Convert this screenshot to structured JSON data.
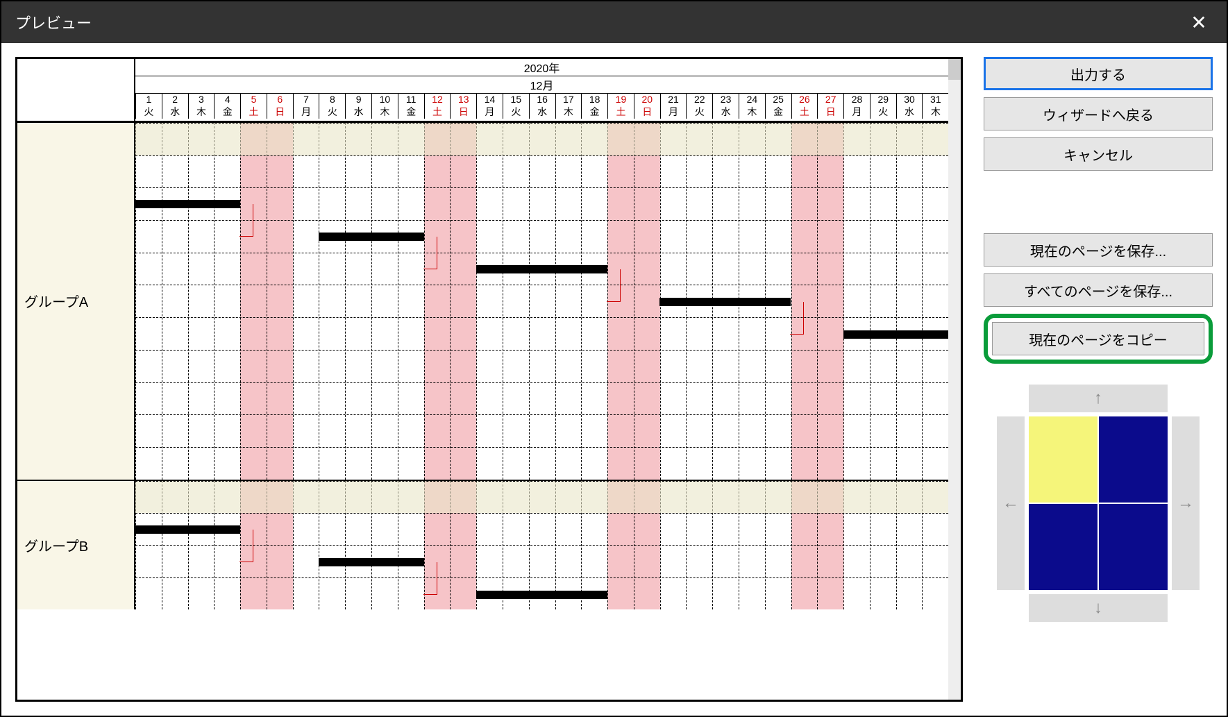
{
  "window": {
    "title": "プレビュー"
  },
  "buttons": {
    "output": "出力する",
    "back_wizard": "ウィザードへ戻る",
    "cancel": "キャンセル",
    "save_current": "現在のページを保存...",
    "save_all": "すべてのページを保存...",
    "copy_current": "現在のページをコピー"
  },
  "nav": {
    "up": "↑",
    "down": "↓",
    "left": "←",
    "right": "→"
  },
  "calendar": {
    "year": "2020年",
    "month": "12月",
    "days": [
      "1",
      "2",
      "3",
      "4",
      "5",
      "6",
      "7",
      "8",
      "9",
      "10",
      "11",
      "12",
      "13",
      "14",
      "15",
      "16",
      "17",
      "18",
      "19",
      "20",
      "21",
      "22",
      "23",
      "24",
      "25",
      "26",
      "27",
      "28",
      "29",
      "30",
      "31"
    ],
    "dow": [
      "火",
      "水",
      "木",
      "金",
      "土",
      "日",
      "月",
      "火",
      "水",
      "木",
      "金",
      "土",
      "日",
      "月",
      "火",
      "水",
      "木",
      "金",
      "土",
      "日",
      "月",
      "火",
      "水",
      "木",
      "金",
      "土",
      "日",
      "月",
      "火",
      "水",
      "木"
    ],
    "weekend_idx": [
      4,
      5,
      11,
      12,
      18,
      19,
      25,
      26
    ]
  },
  "groups": [
    {
      "name": "グループA",
      "rows": 11,
      "bars": [
        {
          "row": 2,
          "start": 0,
          "end": 4
        },
        {
          "row": 3,
          "start": 7,
          "end": 11
        },
        {
          "row": 4,
          "start": 13,
          "end": 18
        },
        {
          "row": 5,
          "start": 20,
          "end": 25
        },
        {
          "row": 6,
          "start": 27,
          "end": 31
        }
      ]
    },
    {
      "name": "グループB",
      "rows": 4,
      "bars": [
        {
          "row": 1,
          "start": 0,
          "end": 4
        },
        {
          "row": 2,
          "start": 7,
          "end": 11
        },
        {
          "row": 3,
          "start": 13,
          "end": 18
        }
      ]
    }
  ]
}
